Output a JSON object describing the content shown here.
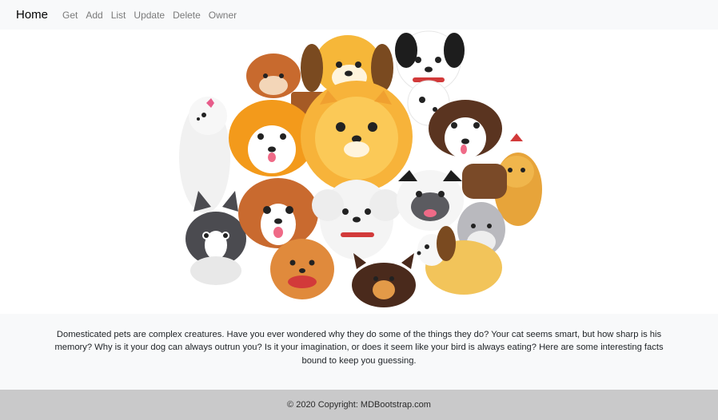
{
  "nav": {
    "brand": "Home",
    "links": [
      "Get",
      "Add",
      "List",
      "Update",
      "Delete",
      "Owner"
    ]
  },
  "hero": {
    "image": "cartoon-dogs-group-illustration"
  },
  "content": {
    "description": "Domesticated pets are complex creatures. Have you ever wondered why they do some of the things they do? Your cat seems smart, but how sharp is his memory? Why is it your dog can always outrun you? Is it your imagination, or does it seem like your bird is always eating? Here are some interesting facts bound to keep you guessing."
  },
  "footer": {
    "copyright": "© 2020 Copyright: MDBootstrap.com"
  },
  "colors": {
    "navbar_bg": "#f8f9fa",
    "footer_bg": "#c9c9ca",
    "text": "#212529",
    "nav_link": "#7a7a7a"
  }
}
